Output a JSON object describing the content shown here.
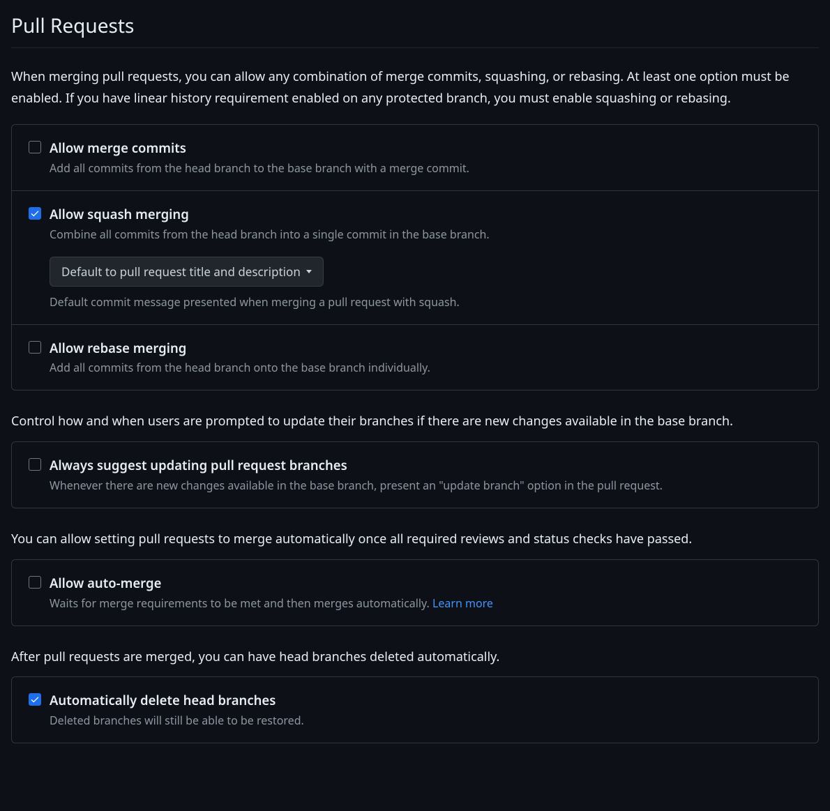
{
  "title": "Pull Requests",
  "intro": "When merging pull requests, you can allow any combination of merge commits, squashing, or rebasing. At least one option must be enabled. If you have linear history requirement enabled on any protected branch, you must enable squashing or rebasing.",
  "merge_options": {
    "merge_commits": {
      "label": "Allow merge commits",
      "desc": "Add all commits from the head branch to the base branch with a merge commit.",
      "checked": false
    },
    "squash": {
      "label": "Allow squash merging",
      "desc": "Combine all commits from the head branch into a single commit in the base branch.",
      "checked": true,
      "dropdown_label": "Default to pull request title and description",
      "dropdown_help": "Default commit message presented when merging a pull request with squash."
    },
    "rebase": {
      "label": "Allow rebase merging",
      "desc": "Add all commits from the head branch onto the base branch individually.",
      "checked": false
    }
  },
  "update_section_text": "Control how and when users are prompted to update their branches if there are new changes available in the base branch.",
  "update_option": {
    "label": "Always suggest updating pull request branches",
    "desc": "Whenever there are new changes available in the base branch, present an \"update branch\" option in the pull request.",
    "checked": false
  },
  "auto_merge_section_text": "You can allow setting pull requests to merge automatically once all required reviews and status checks have passed.",
  "auto_merge_option": {
    "label": "Allow auto-merge",
    "desc_prefix": "Waits for merge requirements to be met and then merges automatically. ",
    "learn_more": "Learn more",
    "checked": false
  },
  "delete_section_text": "After pull requests are merged, you can have head branches deleted automatically.",
  "delete_option": {
    "label": "Automatically delete head branches",
    "desc": "Deleted branches will still be able to be restored.",
    "checked": true
  }
}
